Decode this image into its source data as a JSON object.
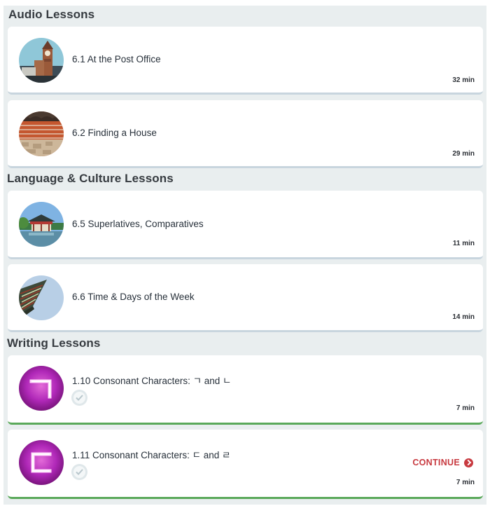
{
  "sections": [
    {
      "title": "Audio Lessons",
      "lessons": [
        {
          "title": "6.1 At the Post Office",
          "duration": "32 min",
          "image": "clock-tower-thumbnail"
        },
        {
          "title": "6.2 Finding a House",
          "duration": "29 min",
          "image": "brick-wall-thumbnail"
        }
      ]
    },
    {
      "title": "Language & Culture Lessons",
      "lessons": [
        {
          "title": "6.5 Superlatives, Comparatives",
          "duration": "11 min",
          "image": "pavilion-thumbnail"
        },
        {
          "title": "6.6 Time & Days of the Week",
          "duration": "14 min",
          "image": "roof-eaves-thumbnail"
        }
      ]
    },
    {
      "title": "Writing Lessons",
      "lessons": [
        {
          "title": "1.10 Consonant Characters: ㄱ and ㄴ",
          "duration": "7 min",
          "image": "neon-giyeok-thumbnail",
          "completed": true
        },
        {
          "title": "1.11 Consonant Characters: ㄷ and ㄹ",
          "duration": "7 min",
          "image": "neon-digeut-thumbnail",
          "completed": true,
          "action": "CONTINUE"
        }
      ]
    }
  ],
  "colors": {
    "section_bg": "#e9eeef",
    "card_border": "#c8d5de",
    "completed_border": "#5aa95a",
    "continue": "#c83a40",
    "neon_purple": "#b028b8"
  }
}
